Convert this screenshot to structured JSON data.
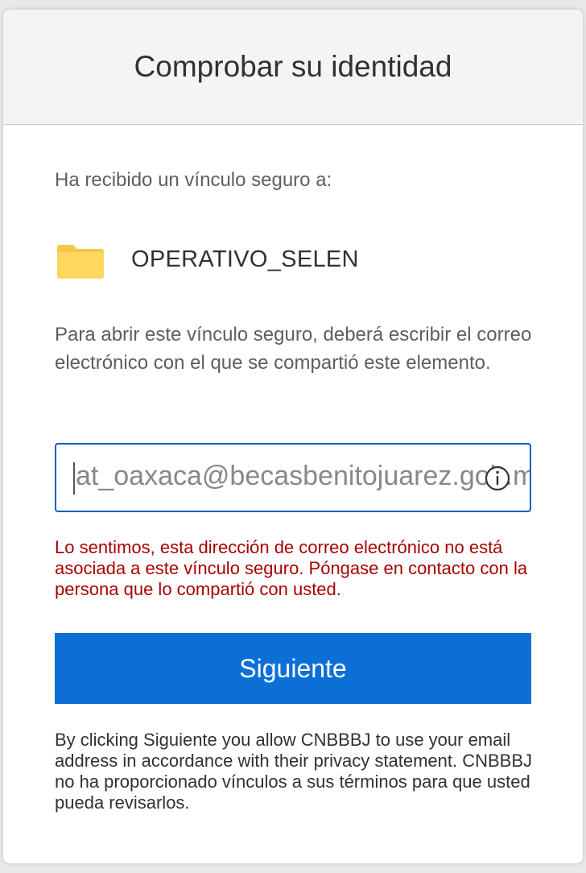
{
  "header": {
    "title": "Comprobar su identidad"
  },
  "main": {
    "intro_text": "Ha recibido un vínculo seguro a:",
    "file": {
      "icon": "folder-icon",
      "name": "OPERATIVO_SELEN"
    },
    "instructions": "Para abrir este vínculo seguro, deberá escribir el correo electrónico con el que se compartió este elemento.",
    "email_input": {
      "value": "at_oaxaca@becasbenitojuarez.gob.mx",
      "icon": "info-icon"
    },
    "error_message": "Lo sentimos, esta dirección de correo electrónico no está asociada a este vínculo seguro. Póngase en contacto con la persona que lo compartió con usted.",
    "next_button_label": "Siguiente",
    "legal_text": "By clicking Siguiente you allow CNBBBJ to use your email address in accordance with their privacy statement. CNBBBJ no ha proporcionado vínculos a sus términos para que usted pueda revisarlos."
  },
  "colors": {
    "accent": "#0c6fd6",
    "error": "#a80000",
    "input_border": "#0b5ebf",
    "folder": "#ffd75e"
  }
}
